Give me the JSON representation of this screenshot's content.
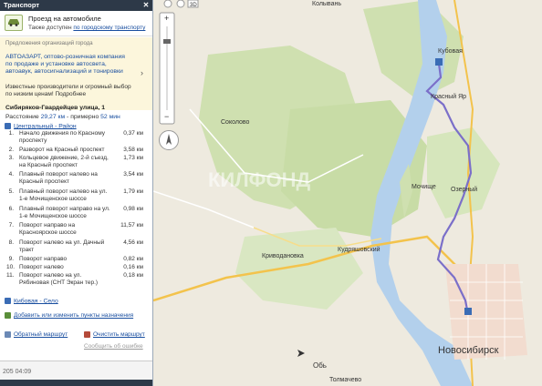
{
  "sidebar": {
    "header_title": "Транспорт",
    "close_glyph": "✕",
    "mode_title": "Проезд на автомобиле",
    "mode_sub_prefix": "Также доступен",
    "mode_sub_link": "по городскому транспорту",
    "ad": {
      "label": "Предложения организаций города",
      "title": "АВТОАЗАРТ, оптово-розничная компания по продаже и установке автосвета, автоавук, автосигнализаций и тонировки",
      "text": "Известные производители и огромный выбор по низким ценам! Подробнее",
      "address": "Сибиряков-Гвардейцев улица, 1",
      "arrow": "›"
    },
    "distance_label": "Расстояние",
    "distance_value": "29,27 км",
    "time_label": "- примерно",
    "time_value": "52 мин",
    "route_start": "Центральный - Район",
    "steps": [
      {
        "n": "1.",
        "text": "Начало движения по Красному проспекту",
        "km": "0,37 км"
      },
      {
        "n": "2.",
        "text": "Разворот на Красный проспект",
        "km": "3,58 км"
      },
      {
        "n": "3.",
        "text": "Кольцевое движение, 2-й съезд, на Красный проспект",
        "km": "1,73 км"
      },
      {
        "n": "4.",
        "text": "Плавный поворот налево на Красный проспект",
        "km": "3,54 км"
      },
      {
        "n": "5.",
        "text": "Плавный поворот налево на ул. 1-е Мочищенское шоссе",
        "km": "1,79 км"
      },
      {
        "n": "6.",
        "text": "Плавный поворот направо на ул. 1-е Мочищенское шоссе",
        "km": "0,98 км"
      },
      {
        "n": "7.",
        "text": "Поворот направо на Красноярское шоссе",
        "km": "11,57 км"
      },
      {
        "n": "8.",
        "text": "Поворот налево на ул. Дачный тракт",
        "km": "4,56 км"
      },
      {
        "n": "9.",
        "text": "Поворот направо",
        "km": "0,82 км"
      },
      {
        "n": "10.",
        "text": "Поворот налево",
        "km": "0,16 км"
      },
      {
        "n": "11.",
        "text": "Поворот налево на ул. Рябиновая (СНТ Экран тер.)",
        "km": "0,18 км"
      }
    ],
    "route_end": "Кибовая - Село",
    "add_points": "Добавить или изменить пункты назначения",
    "reverse": "Обратный маршрут",
    "clear": "Очистить маршрут",
    "report": "Сообщить об ошибке",
    "status": "205 04:09"
  },
  "map": {
    "labels": {
      "kubovaya": "Кубовая",
      "krasny_yar": "Красный Яр",
      "sokolovo": "Соколово",
      "mochishche": "Мочище",
      "ozerny": "Озерный",
      "kudryashovsky": "Кудряшовский",
      "krivodanovka": "Криводановка",
      "novosibirsk": "Новосибирск",
      "ob": "Обь",
      "tolmachevo": "Толмачево",
      "kolyvan": "Колывань",
      "watermark": "КИЛФОНД"
    },
    "zoom_plus": "+",
    "zoom_minus": "−",
    "btn_3d": "3D",
    "route_color": "#7b6fc9",
    "water_color": "#b3d0ec",
    "forest_color": "#cfe0b0"
  }
}
